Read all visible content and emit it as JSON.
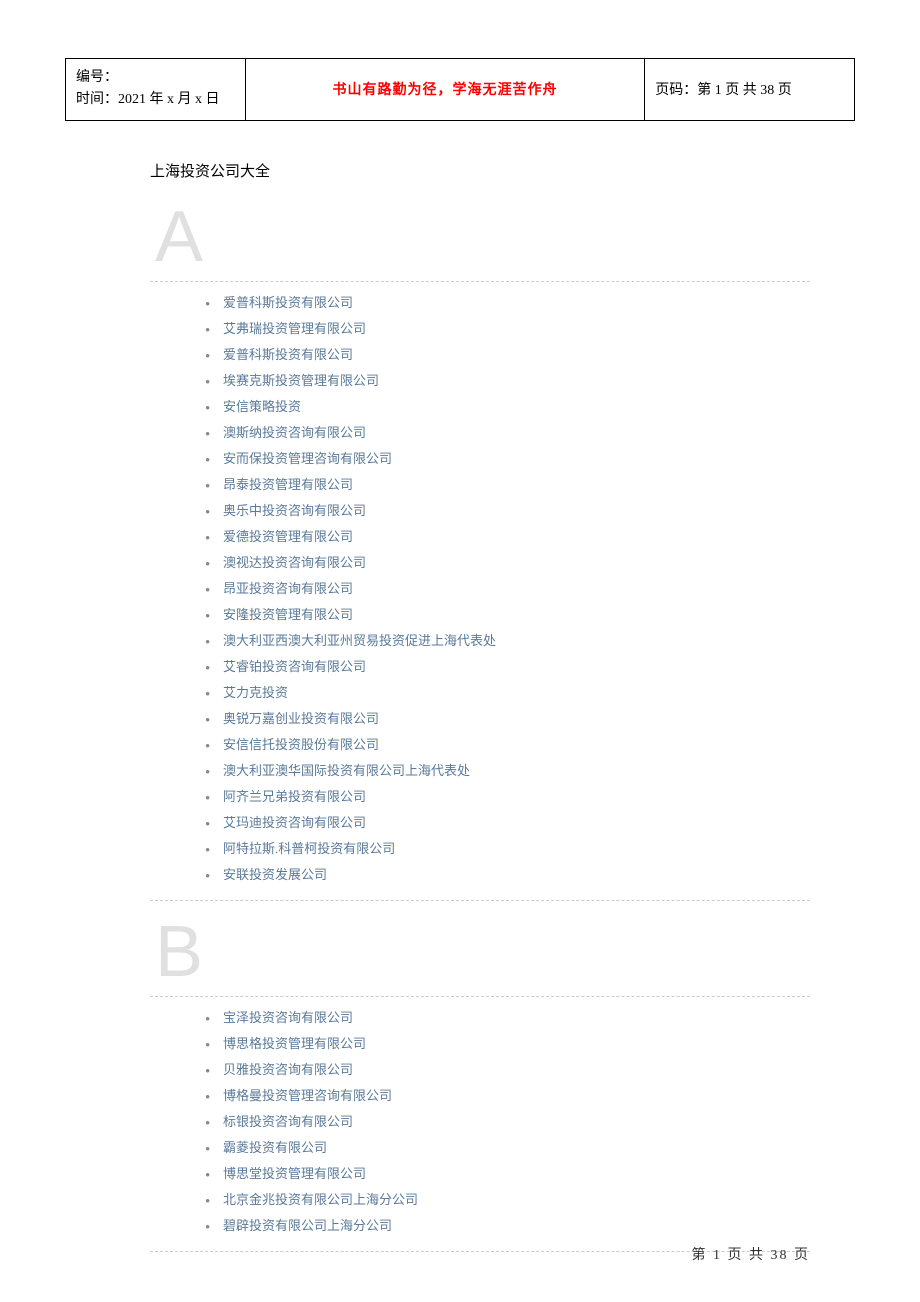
{
  "header": {
    "numbering_label": "编号：",
    "time_label": "时间：2021 年 x 月 x 日",
    "motto": "书山有路勤为径，学海无涯苦作舟",
    "page_label": "页码：第 1 页 共 38 页"
  },
  "title": "上海投资公司大全",
  "sections": [
    {
      "letter": "A",
      "companies": [
        "爱普科斯投资有限公司",
        "艾弗瑞投资管理有限公司",
        "爱普科斯投资有限公司",
        "埃赛克斯投资管理有限公司",
        "安信策略投资",
        "澳斯纳投资咨询有限公司",
        "安而保投资管理咨询有限公司",
        "昂泰投资管理有限公司",
        "奥乐中投资咨询有限公司",
        "爱德投资管理有限公司",
        "澳视达投资咨询有限公司",
        "昂亚投资咨询有限公司",
        "安隆投资管理有限公司",
        "澳大利亚西澳大利亚州贸易投资促进上海代表处",
        "艾睿铂投资咨询有限公司",
        "艾力克投资",
        "奥锐万嘉创业投资有限公司",
        "安信信托投资股份有限公司",
        "澳大利亚澳华国际投资有限公司上海代表处",
        "阿齐兰兄弟投资有限公司",
        "艾玛迪投资咨询有限公司",
        "阿特拉斯.科普柯投资有限公司",
        "安联投资发展公司"
      ]
    },
    {
      "letter": "B",
      "companies": [
        "宝泽投资咨询有限公司",
        "博思格投资管理有限公司",
        "贝雅投资咨询有限公司",
        "博格曼投资管理咨询有限公司",
        "标银投资咨询有限公司",
        "霸菱投资有限公司",
        "博思堂投资管理有限公司",
        "北京金兆投资有限公司上海分公司",
        "碧辟投资有限公司上海分公司"
      ]
    }
  ],
  "footer": "第 1 页 共 38 页"
}
